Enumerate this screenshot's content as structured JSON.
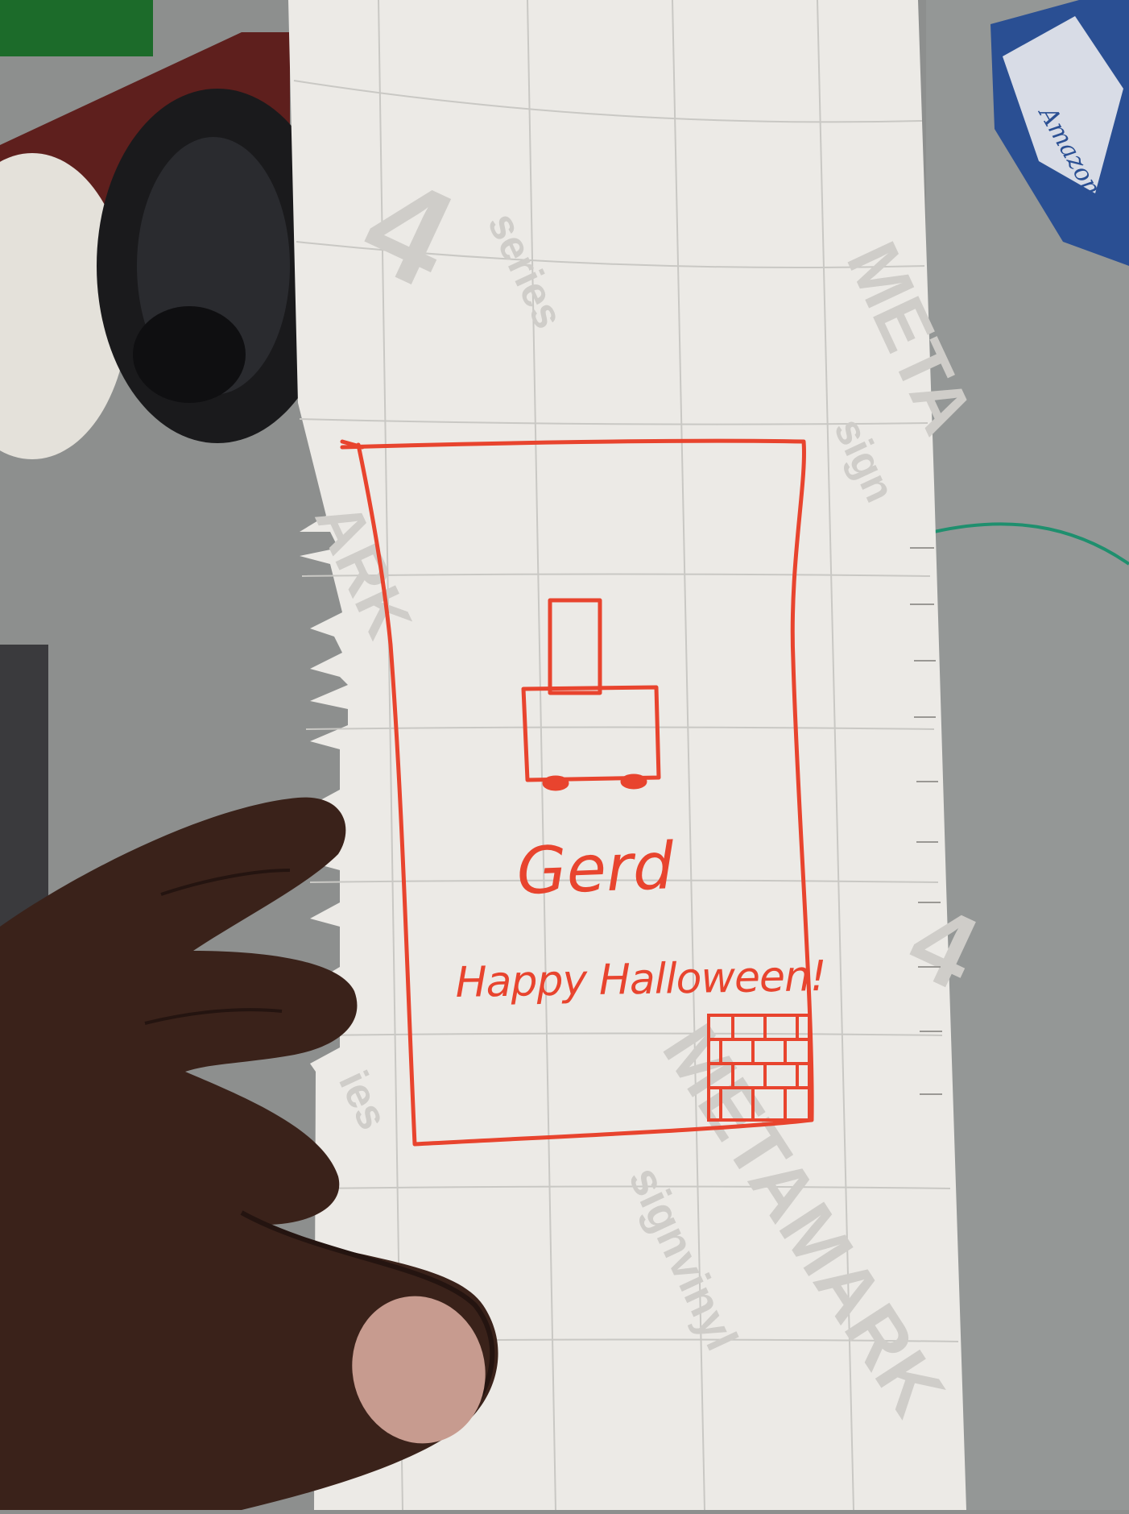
{
  "photo": {
    "card": {
      "name_text": "Gerd",
      "greeting_text": "Happy Halloween!",
      "ink_color": "#e8442e"
    },
    "paper": {
      "background_color": "#eceae6",
      "grid_color": "#c9c8c4",
      "watermark_color": "#cfcdc9",
      "watermark_texts": [
        "4",
        "series",
        "META",
        "sign",
        "ARK",
        "4",
        "ies",
        "signvinyl",
        "METAMARK"
      ]
    },
    "tissue_box_text": "Amazon",
    "colors": {
      "desk": "#8d8f8e",
      "skin": "#3a221a",
      "headphones": "#1a1a1c",
      "green_object": "#1c6b2a",
      "tissue_box": "#2a4f93",
      "wire": "#1f8f6e"
    }
  }
}
